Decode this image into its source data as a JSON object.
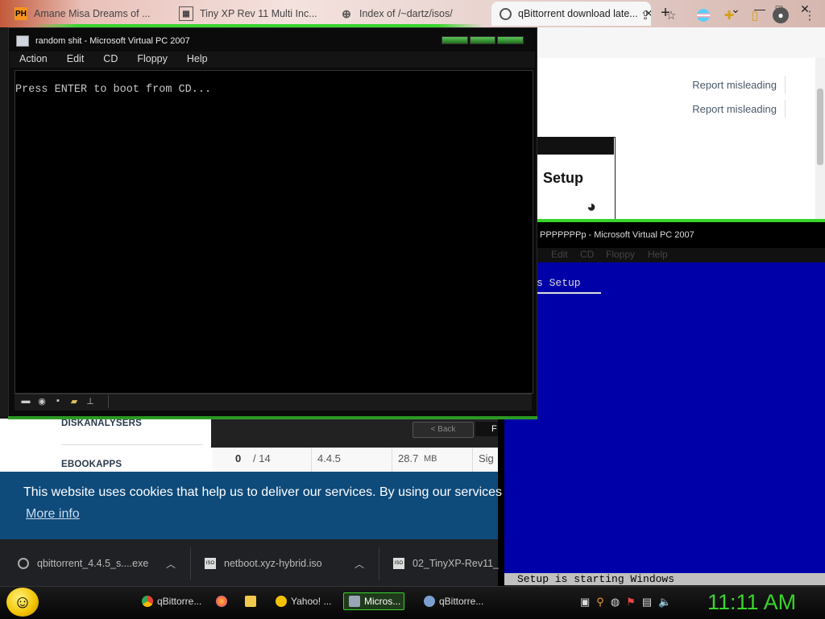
{
  "browser": {
    "tabs": [
      {
        "label": "Amane Misa Dreams of ...",
        "icon": "PH"
      },
      {
        "label": "Tiny XP Rev 11 Multi Inc...",
        "icon": "page"
      },
      {
        "label": "Index of /~dartz/isos/",
        "icon": "globe"
      },
      {
        "label": "qBittorrent download late...",
        "icon": "circle",
        "active": true
      }
    ],
    "new_tab": "+",
    "window_controls": {
      "minimize": "—",
      "maximize": "□",
      "close": "✕"
    }
  },
  "web": {
    "report_links": [
      "Report misleading",
      "Report misleading"
    ],
    "sidebar_items": [
      "DISKANALYSERS",
      "EBOOKAPPS"
    ],
    "nav": {
      "back": "< Back",
      "next": "F"
    },
    "table_row": [
      "0",
      "/ 14",
      "4.4.5",
      "28.7",
      "MB",
      "Sig"
    ],
    "cookie": {
      "text": "This website uses cookies that help us to deliver our services. By using our services",
      "more_info": "More info"
    }
  },
  "downloads": [
    {
      "name": "qbittorrent_4.4.5_s....exe"
    },
    {
      "name": "netboot.xyz-hybrid.iso"
    },
    {
      "name": "02_TinyXP-Rev11_"
    }
  ],
  "setup_window": {
    "title": "Setup"
  },
  "vpc_main": {
    "title": "random shit - Microsoft Virtual PC 2007",
    "menu": [
      "Action",
      "Edit",
      "CD",
      "Floppy",
      "Help"
    ],
    "screen_text": "Press ENTER to boot from CD..."
  },
  "vpc_second": {
    "title": "PPPPPPPp - Microsoft Virtual PC 2007",
    "menu": [
      "Edit",
      "CD",
      "Floppy",
      "Help"
    ],
    "screen_heading": "s Setup",
    "status": "Setup is starting Windows"
  },
  "taskbar": {
    "buttons": [
      {
        "label": "qBittorre...",
        "color": "#4285f4"
      },
      {
        "label": "",
        "color": "#ff7139"
      },
      {
        "label": "",
        "color": "#f2c94c"
      },
      {
        "label": "Yahoo! ...",
        "color": "#f2c200"
      },
      {
        "label": "Micros...",
        "color": "#9aa6b8",
        "active": true
      },
      {
        "label": "qBittorre...",
        "color": "#7aa0d0"
      }
    ],
    "clock": "11:11 AM"
  },
  "colors": {
    "accent_green": "#39d42c",
    "setup_blue": "#0000a8",
    "cookie_blue": "#0e4a7a"
  }
}
